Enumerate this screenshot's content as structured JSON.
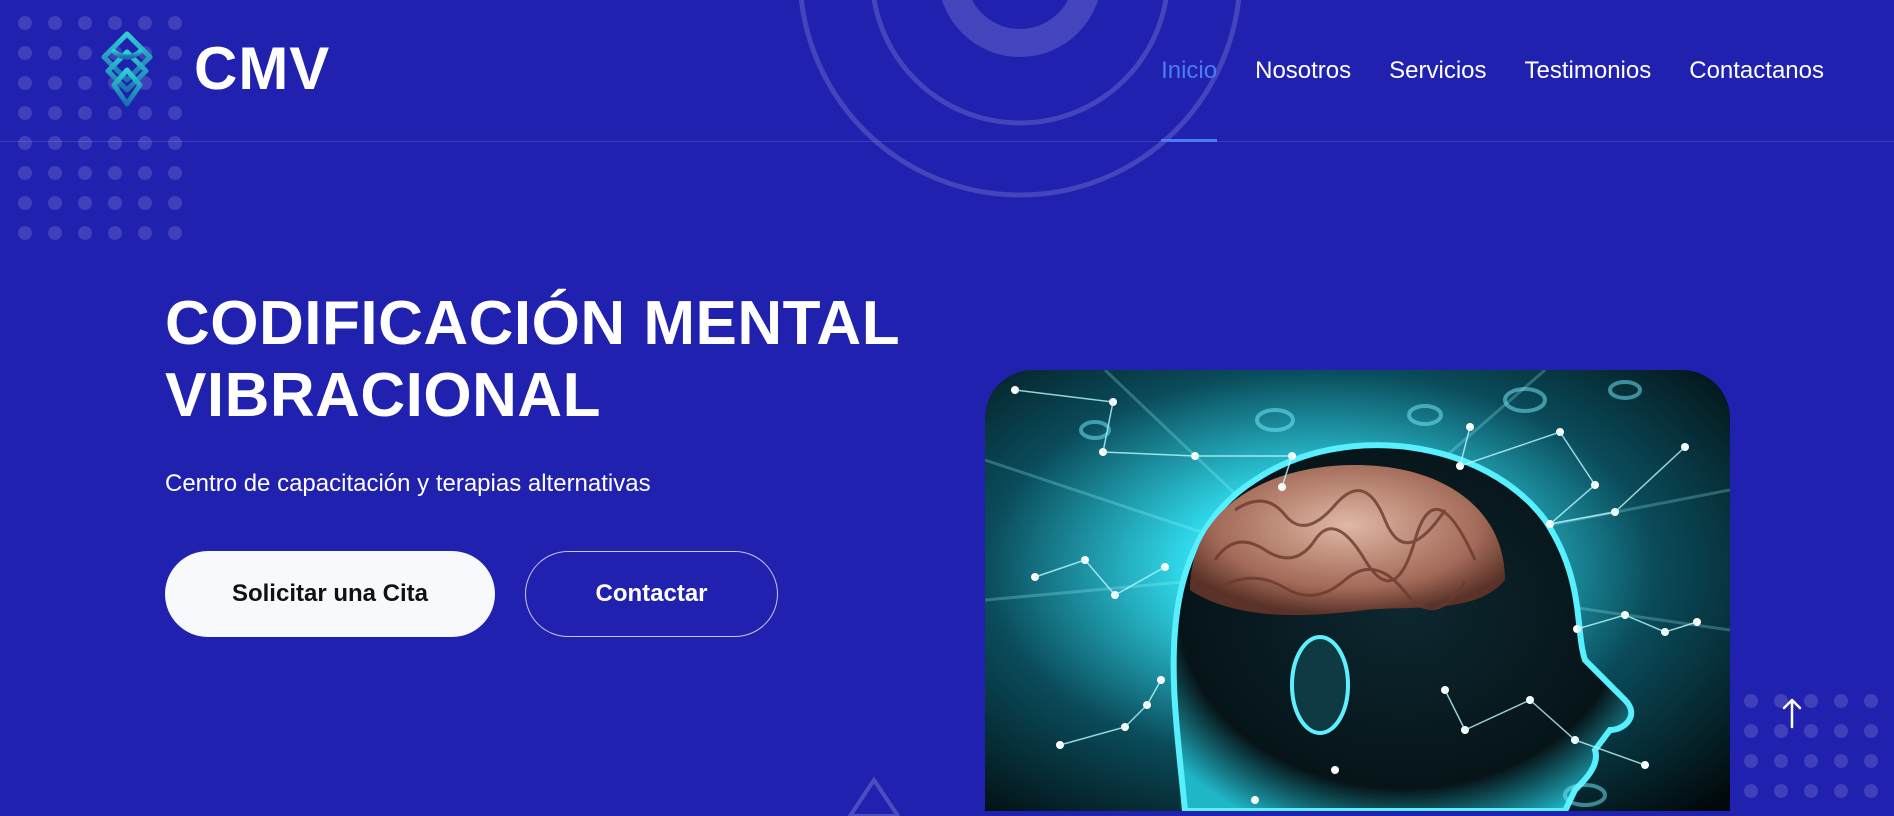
{
  "brand": {
    "name": "CMV"
  },
  "nav": {
    "items": [
      {
        "label": "Inicio",
        "active": true
      },
      {
        "label": "Nosotros"
      },
      {
        "label": "Servicios"
      },
      {
        "label": "Testimonios"
      },
      {
        "label": "Contactanos"
      }
    ]
  },
  "hero": {
    "title_line1": "CODIFICACIÓN MENTAL",
    "title_line2": "VIBRACIONAL",
    "subtitle": "Centro de capacitación y terapias alternativas",
    "primary_button": "Solicitar una Cita",
    "secondary_button": "Contactar",
    "image_icon": "brain-head-illustration"
  },
  "icons": {
    "logo": "knot-logo-icon",
    "scroll_top": "arrow-up-icon"
  },
  "colors": {
    "background": "#2121b0",
    "accent": "#4a7cf2",
    "button_light": "#f7f9fd",
    "image_glow": "#2ee6ff"
  }
}
